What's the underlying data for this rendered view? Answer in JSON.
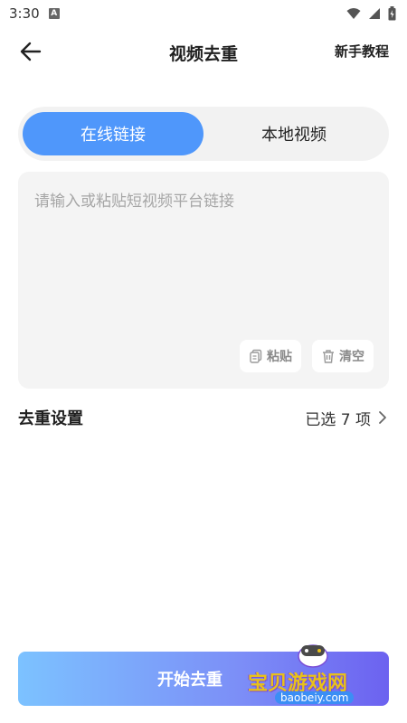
{
  "status_bar": {
    "time": "3:30",
    "notif_icon_letter": "A"
  },
  "header": {
    "title": "视频去重",
    "tutorial": "新手教程"
  },
  "tabs": [
    {
      "label": "在线链接",
      "active": true
    },
    {
      "label": "本地视频",
      "active": false
    }
  ],
  "link_input": {
    "placeholder": "请输入或粘贴短视频平台链接",
    "value": ""
  },
  "box_buttons": {
    "paste": "粘贴",
    "clear": "清空"
  },
  "settings": {
    "label": "去重设置",
    "value": "已选 7 项"
  },
  "start_button": {
    "label": "开始去重"
  },
  "watermark": {
    "title": "宝贝游戏网",
    "site": "baobeiy.com"
  },
  "colors": {
    "accent": "#4f97fb",
    "gradient_start": "#7cc2ff",
    "gradient_end": "#6c62f0"
  }
}
